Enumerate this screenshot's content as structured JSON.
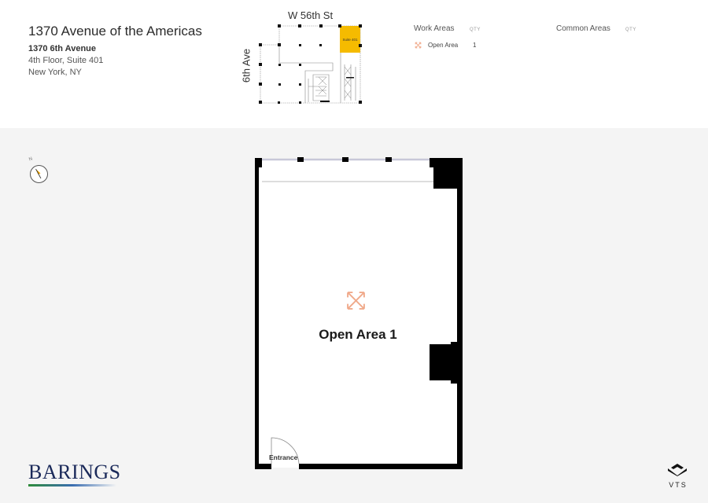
{
  "header": {
    "building_title": "1370 Avenue of the Americas",
    "address_line1": "1370 6th Avenue",
    "address_line2": "4th Floor, Suite 401",
    "address_line3": "New York, NY"
  },
  "keyplan": {
    "street_north": "W 56th St",
    "street_west": "6th Ave",
    "highlighted_suite_label": "Suite 401",
    "highlight_color": "#f5bb00"
  },
  "legend": {
    "work_areas": {
      "title": "Work Areas",
      "qty_header": "QTY",
      "items": [
        {
          "icon": "expand-arrows-icon",
          "label": "Open Area",
          "qty": "1",
          "color": "#f0a98a"
        }
      ]
    },
    "common_areas": {
      "title": "Common Areas",
      "qty_header": "QTY",
      "items": []
    }
  },
  "compass": {
    "north_label": "N",
    "icon": "compass-icon",
    "needle_color": "#f5a800"
  },
  "floorplan": {
    "area_label": "Open Area 1",
    "area_icon": "expand-arrows-icon",
    "area_icon_color": "#f0a98a",
    "entrance_label": "Entrance"
  },
  "branding": {
    "client_logo_text": "BARINGS",
    "client_logo_color": "#1b2a5a",
    "vendor_logo_text": "VTS"
  }
}
